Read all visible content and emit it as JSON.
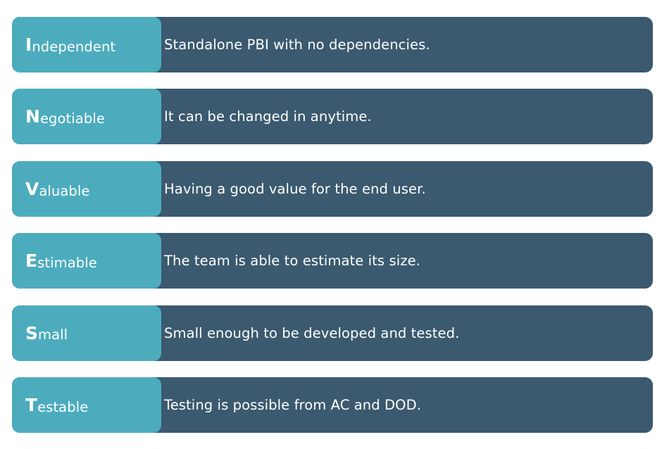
{
  "items": [
    {
      "initial": "I",
      "rest": "ndependent",
      "description": "Standalone PBI with no dependencies."
    },
    {
      "initial": "N",
      "rest": "egotiable",
      "description": "It can be changed in anytime."
    },
    {
      "initial": "V",
      "rest": "aluable",
      "description": "Having a good value for the end user."
    },
    {
      "initial": "E",
      "rest": "stimable",
      "description": "The team is able to estimate its size."
    },
    {
      "initial": "S",
      "rest": "mall",
      "description": "Small enough to be developed and tested."
    },
    {
      "initial": "T",
      "rest": "estable",
      "description": "Testing is possible from AC and DOD."
    }
  ],
  "colors": {
    "term_background": "#4cacbd",
    "description_background": "#3b5a6f",
    "text": "#ffffff"
  }
}
